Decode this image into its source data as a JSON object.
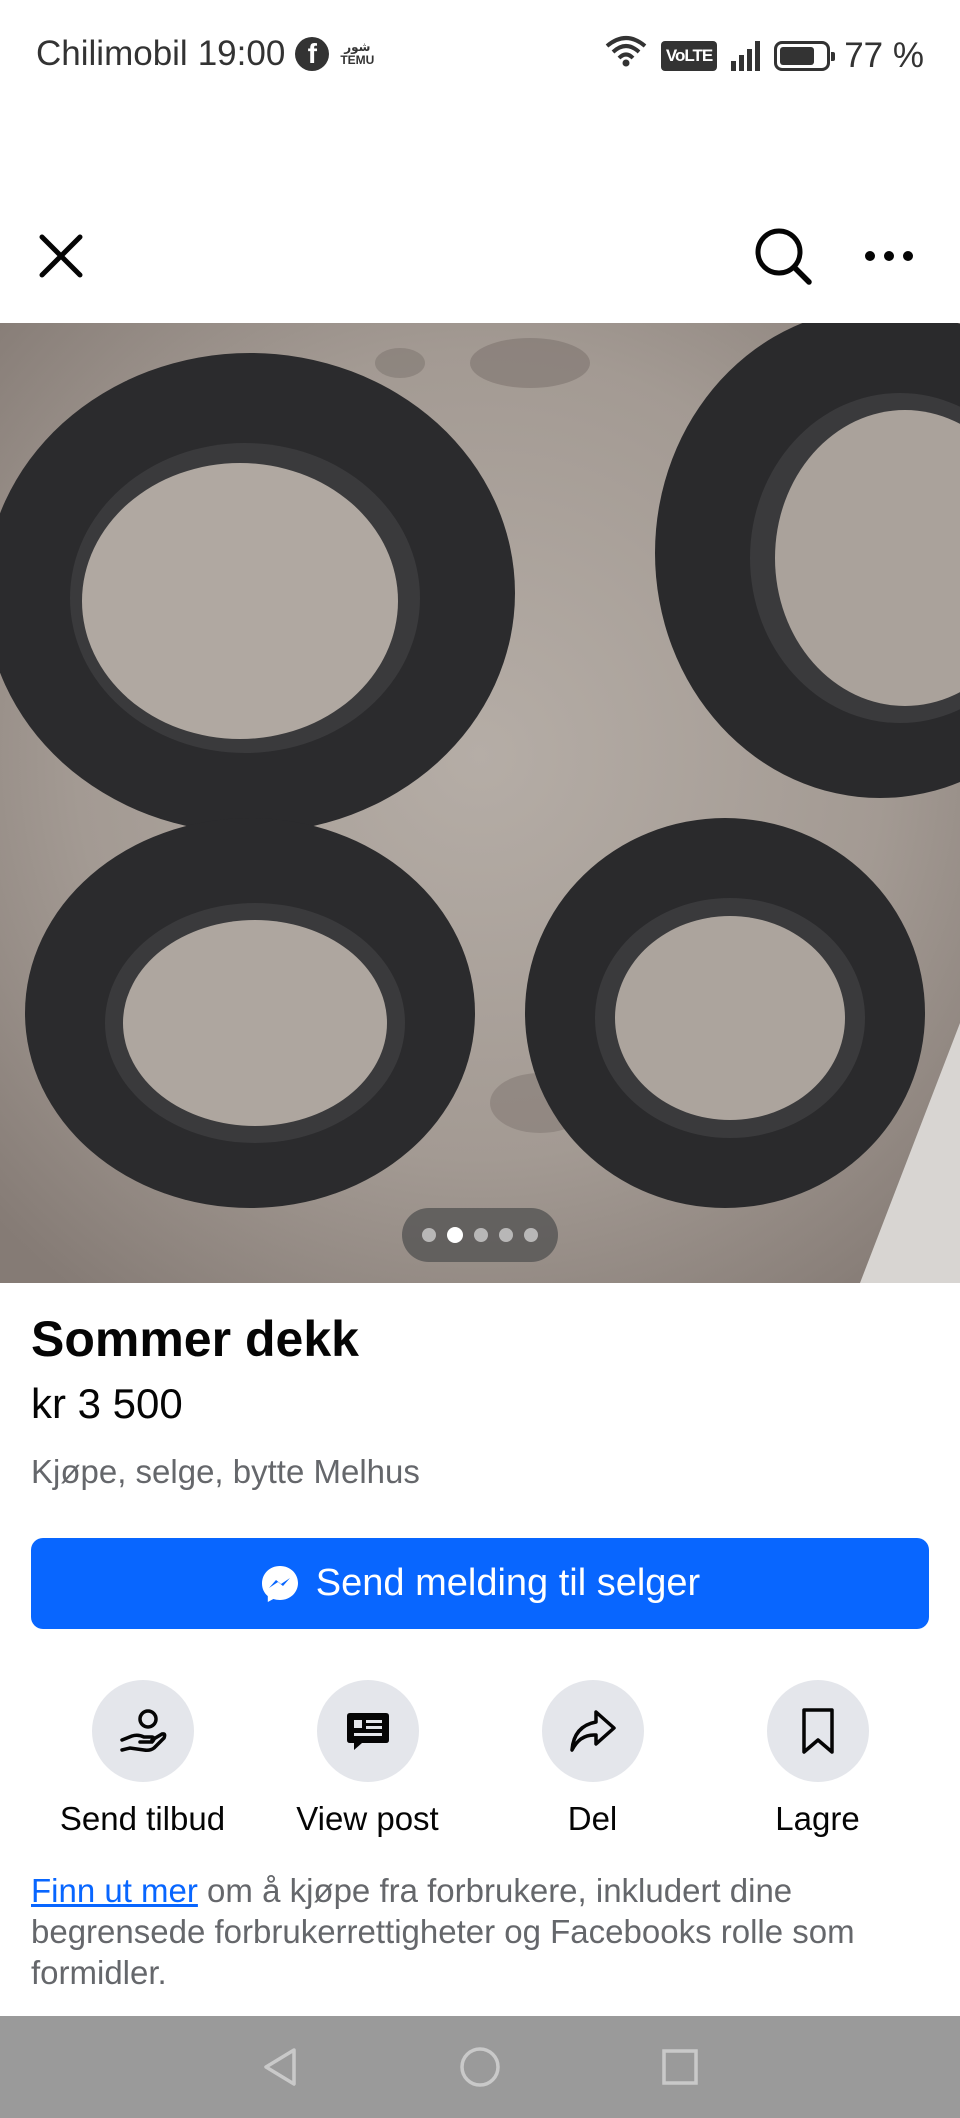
{
  "status_bar": {
    "carrier": "Chilimobil",
    "time": "19:00",
    "fb_letter": "f",
    "temu_top": "شور",
    "temu_bottom": "TEMU",
    "volte": "VoLTE",
    "battery_percent": "77 %",
    "battery_level": 0.77
  },
  "header": {
    "close_icon": "close-icon",
    "search_icon": "search-icon",
    "more_icon": "more-horizontal-icon"
  },
  "photo": {
    "page_count": 5,
    "current_page": 2,
    "description_icon": "tire-photo"
  },
  "listing": {
    "title": "Sommer dekk",
    "price": "kr 3 500",
    "group": "Kjøpe, selge, bytte Melhus"
  },
  "send_button": {
    "label": "Send melding til selger",
    "icon": "messenger-icon"
  },
  "actions": [
    {
      "label": "Send tilbud",
      "icon": "offer-hand-icon"
    },
    {
      "label": "View post",
      "icon": "post-icon"
    },
    {
      "label": "Del",
      "icon": "share-icon"
    },
    {
      "label": "Lagre",
      "icon": "bookmark-icon"
    }
  ],
  "info": {
    "link_text": "Finn ut mer",
    "rest_text": " om å kjøpe fra forbrukere, inkludert dine begrensede forbrukerrettigheter og Facebooks rolle som formidler."
  },
  "colors": {
    "primary": "#0866ff",
    "secondary_text": "#65676b",
    "action_circle": "#e4e6eb",
    "nav_bar": "#9a9a9a"
  }
}
